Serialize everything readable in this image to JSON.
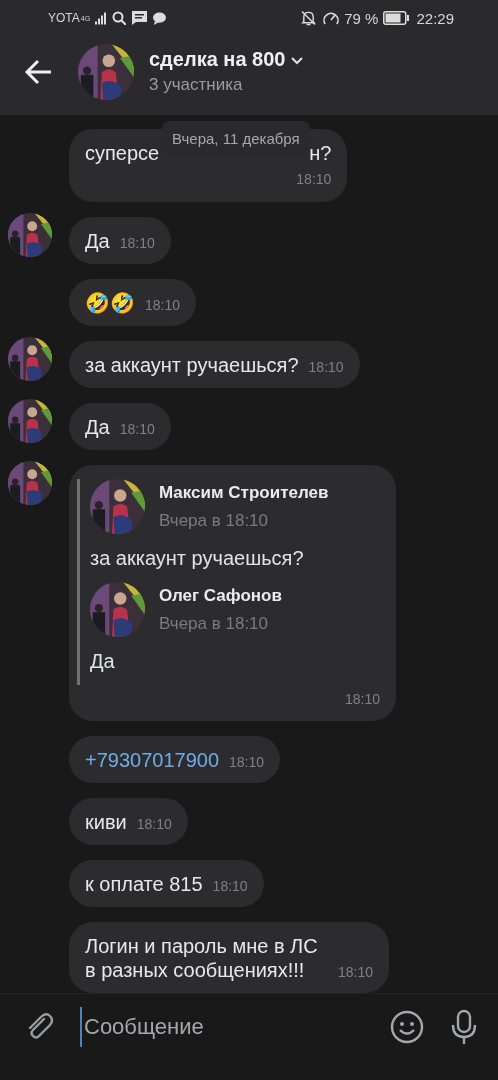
{
  "status_bar": {
    "carrier": "YOTA",
    "network": "4G",
    "battery": "79 %",
    "time": "22:29"
  },
  "header": {
    "title": "сделка на 800",
    "subtitle": "3 участника"
  },
  "date_pill": "Вчера, 11 декабря",
  "messages": [
    {
      "kind": "text",
      "text_parts": [
        "суперсе",
        "н?"
      ],
      "time": "18:10",
      "time_below": true
    },
    {
      "kind": "text",
      "text": "Да",
      "time": "18:10"
    },
    {
      "kind": "text",
      "text": "🤣🤣",
      "time": "18:10"
    },
    {
      "kind": "text",
      "text": "за аккаунт ручаешься?",
      "time": "18:10"
    },
    {
      "kind": "text",
      "text": "Да",
      "time": "18:10"
    },
    {
      "kind": "forward",
      "time": "18:10",
      "quotes": [
        {
          "author": "Максим Строителев",
          "date": "Вчера в 18:10",
          "text": "за аккаунт ручаешься?"
        },
        {
          "author": "Олег Сафонов",
          "date": "Вчера в 18:10",
          "text": "Да"
        }
      ]
    },
    {
      "kind": "link",
      "text": "+79307017900",
      "time": "18:10"
    },
    {
      "kind": "text",
      "text": "киви",
      "time": "18:10"
    },
    {
      "kind": "text",
      "text": "к оплате 815",
      "time": "18:10"
    },
    {
      "kind": "text",
      "text": "Логин и пароль мне в ЛС в разных сообщениях!!!",
      "time": "18:10"
    }
  ],
  "composer": {
    "placeholder": "Сообщение"
  }
}
